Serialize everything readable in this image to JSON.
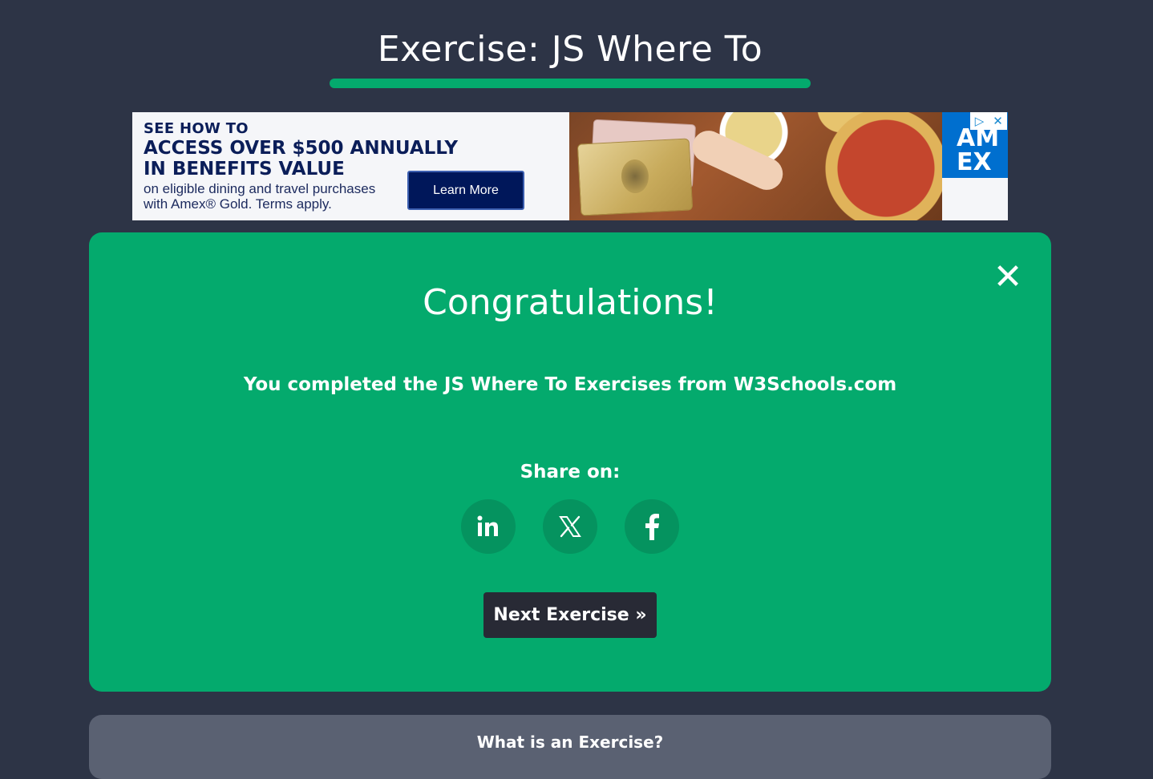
{
  "header": {
    "title": "Exercise: JS Where To"
  },
  "ad": {
    "line1": "SEE HOW TO",
    "line2": "ACCESS OVER $500 ANNUALLY",
    "line3": "IN BENEFITS VALUE",
    "fine_line1": "on eligible dining and travel purchases",
    "fine_line2": "with Amex® Gold. Terms apply.",
    "cta_label": "Learn More",
    "brand_logo": "AM EX",
    "adchoices_icon": "▷",
    "close_icon": "✕"
  },
  "congrats": {
    "heading": "Congratulations!",
    "message": "You completed the JS Where To Exercises from W3Schools.com",
    "share_label": "Share on:",
    "share_buttons": [
      {
        "name": "linkedin",
        "icon": "linkedin-icon"
      },
      {
        "name": "x",
        "icon": "x-icon"
      },
      {
        "name": "facebook",
        "icon": "facebook-icon"
      }
    ],
    "close_icon": "✕",
    "next_label": "Next Exercise »"
  },
  "info": {
    "heading": "What is an Exercise?"
  },
  "colors": {
    "background": "#2d3446",
    "accent": "#04aa6d",
    "share_button": "#05935f",
    "next_button": "#282a35",
    "info_card": "#5a6172"
  }
}
